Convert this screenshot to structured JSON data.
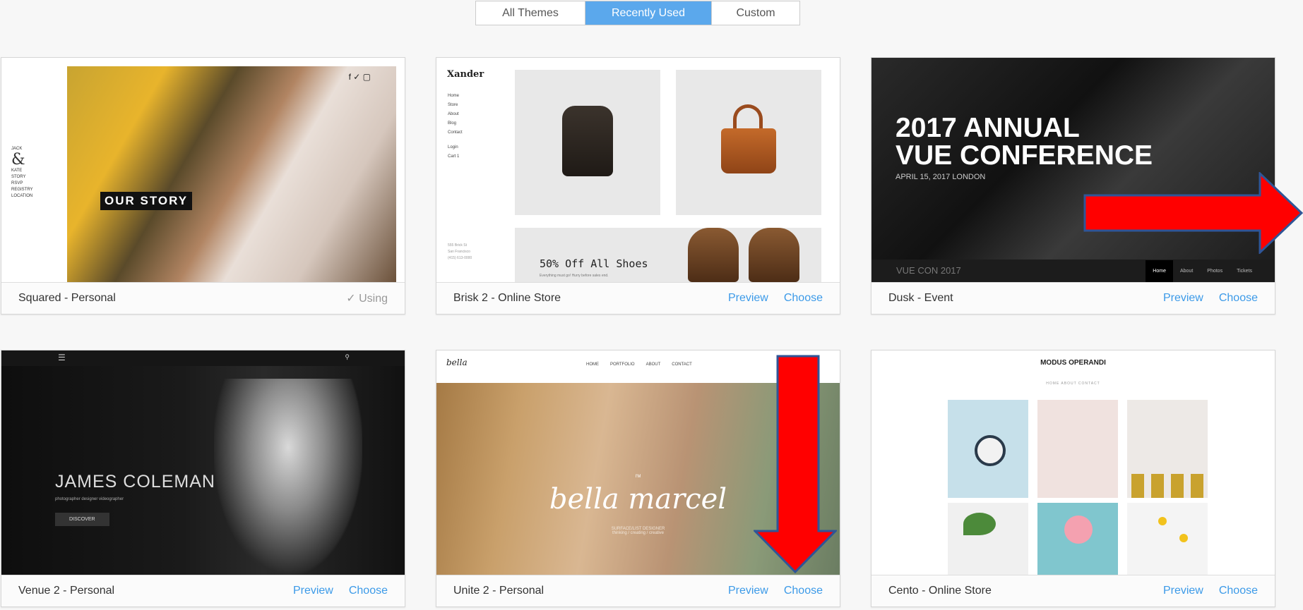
{
  "tabs": [
    {
      "label": "All Themes",
      "active": false
    },
    {
      "label": "Recently Used",
      "active": true
    },
    {
      "label": "Custom",
      "active": false
    }
  ],
  "themes": [
    {
      "name": "Squared - Personal",
      "status": "Using",
      "thumb": {
        "headline": "OUR STORY",
        "mini_names": [
          "JACK",
          "&",
          "KATE"
        ],
        "mini_nav": [
          "STORY",
          "RSVP",
          "REGISTRY",
          "LOCATION"
        ],
        "social": "f ✓ ▢"
      }
    },
    {
      "name": "Brisk 2 - Online Store",
      "preview_label": "Preview",
      "choose_label": "Choose",
      "thumb": {
        "logo": "Xander",
        "nav": [
          "Home",
          "Store",
          "About",
          "Blog",
          "Contact",
          "Login",
          "Cart"
        ],
        "cart_count": "1",
        "banner": "50% Off All Shoes",
        "banner_sub": "Everything must go! Hurry before sales end.",
        "address": [
          "555 Brick St",
          "San Francisco",
          "(415) 613-0000"
        ]
      }
    },
    {
      "name": "Dusk - Event",
      "preview_label": "Preview",
      "choose_label": "Choose",
      "thumb": {
        "headline_line1": "2017 ANNUAL",
        "headline_line2": "VUE CONFERENCE",
        "subtitle": "APRIL 15, 2017 LONDON",
        "brand": "VUE CON 2017",
        "menu": [
          "Home",
          "About",
          "Photos",
          "Tickets"
        ]
      }
    },
    {
      "name": "Venue 2 - Personal",
      "preview_label": "Preview",
      "choose_label": "Choose",
      "thumb": {
        "headline": "JAMES COLEMAN",
        "roles": "photographer   designer   videographer",
        "button": "DISCOVER"
      }
    },
    {
      "name": "Unite 2 - Personal",
      "preview_label": "Preview",
      "choose_label": "Choose",
      "thumb": {
        "logo": "bella",
        "nav": [
          "HOME",
          "PORTFOLIO",
          "ABOUT",
          "CONTACT"
        ],
        "intro": "I'M",
        "headline": "bella marcel",
        "subtitle": "SURFACE/LIST DESIGNER",
        "tags": "thinking / creating / creative"
      }
    },
    {
      "name": "Cento - Online Store",
      "preview_label": "Preview",
      "choose_label": "Choose",
      "thumb": {
        "title": "MODUS OPERANDI",
        "nav": "HOME    ABOUT    CONTACT"
      }
    }
  ],
  "colors": {
    "accent": "#5ba8ec",
    "link": "#3c9ae8",
    "arrow": "#ff0000",
    "arrow_outline": "#2f5597"
  },
  "icons": {
    "using": "check-icon",
    "arrows": [
      "right-arrow-annotation",
      "down-arrow-annotation"
    ]
  }
}
